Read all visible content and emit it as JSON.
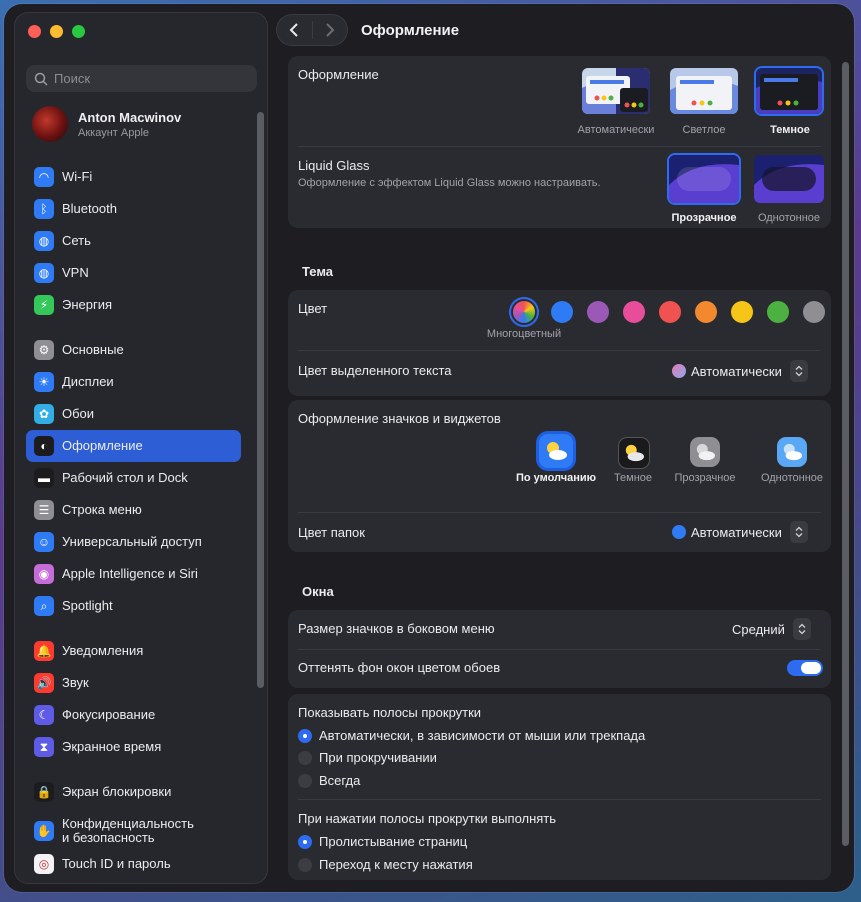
{
  "window": {
    "title": "Оформление"
  },
  "sidebar": {
    "search_placeholder": "Поиск",
    "account": {
      "name": "Anton Macwinov",
      "subtitle": "Аккаунт Apple"
    },
    "items": [
      {
        "label": "Wi-Fi",
        "icon": "wifi-icon",
        "color": "#2f7bf5"
      },
      {
        "label": "Bluetooth",
        "icon": "bluetooth-icon",
        "color": "#2f7bf5"
      },
      {
        "label": "Сеть",
        "icon": "globe-icon",
        "color": "#2f7bf5"
      },
      {
        "label": "VPN",
        "icon": "vpn-globe-icon",
        "color": "#2f7bf5"
      },
      {
        "label": "Энергия",
        "icon": "battery-bolt-icon",
        "color": "#34c759"
      },
      {
        "label": "Основные",
        "icon": "gear-icon",
        "color": "#8e8e93"
      },
      {
        "label": "Дисплеи",
        "icon": "sun-icon",
        "color": "#2f7bf5"
      },
      {
        "label": "Обои",
        "icon": "flower-icon",
        "color": "#32ade6"
      },
      {
        "label": "Оформление",
        "icon": "appearance-icon",
        "color": "#1c1c1e"
      },
      {
        "label": "Рабочий стол и Dock",
        "icon": "dock-icon",
        "color": "#1c1c1e"
      },
      {
        "label": "Строка меню",
        "icon": "menubar-icon",
        "color": "#8e8e93"
      },
      {
        "label": "Универсальный доступ",
        "icon": "accessibility-icon",
        "color": "#2f7bf5"
      },
      {
        "label": "Apple Intelligence и Siri",
        "icon": "siri-icon",
        "color": "#c66cd8"
      },
      {
        "label": "Spotlight",
        "icon": "magnifier-icon",
        "color": "#2f7bf5"
      },
      {
        "label": "Уведомления",
        "icon": "bell-icon",
        "color": "#ff3b30"
      },
      {
        "label": "Звук",
        "icon": "speaker-icon",
        "color": "#ff3b30"
      },
      {
        "label": "Фокусирование",
        "icon": "moon-icon",
        "color": "#5e5ce6"
      },
      {
        "label": "Экранное время",
        "icon": "hourglass-icon",
        "color": "#5e5ce6"
      },
      {
        "label": "Экран блокировки",
        "icon": "lock-icon",
        "color": "#1c1c1e"
      },
      {
        "label": "Конфиденциальность\nи безопасность",
        "icon": "hand-icon",
        "color": "#2f7bf5"
      },
      {
        "label": "Touch ID и пароль",
        "icon": "fingerprint-icon",
        "color": "#f2f2f7"
      }
    ],
    "active_index": 8
  },
  "appearance": {
    "label": "Оформление",
    "options": [
      "Автоматически",
      "Светлое",
      "Темное"
    ],
    "selected": "Темное"
  },
  "liquid_glass": {
    "label": "Liquid Glass",
    "description": "Оформление с эффектом Liquid Glass можно настраивать.",
    "options": [
      "Прозрачное",
      "Однотонное"
    ],
    "selected": "Прозрачное"
  },
  "theme": {
    "title": "Тема",
    "color_label": "Цвет",
    "colors": [
      "#ff9f0a-multi",
      "#2f7bf5",
      "#9b59b6",
      "#e84d9a",
      "#f05252",
      "#f2892e",
      "#f5c518",
      "#4cb140",
      "#8e8e93"
    ],
    "selected_color_caption": "Многоцветный",
    "highlight_label": "Цвет выделенного текста",
    "highlight_value": "Автоматически"
  },
  "icons_widgets": {
    "title": "Оформление значков и виджетов",
    "options": [
      "По умолчанию",
      "Темное",
      "Прозрачное",
      "Однотонное"
    ],
    "selected": "По умолчанию",
    "folder_color_label": "Цвет папок",
    "folder_color_value": "Автоматически"
  },
  "windows": {
    "title": "Окна",
    "sidebar_icon_size_label": "Размер значков в боковом меню",
    "sidebar_icon_size_value": "Средний",
    "tint_label": "Оттенять фон окон цветом обоев",
    "tint_on": true
  },
  "scrollbars": {
    "show_label": "Показывать полосы прокрутки",
    "show_options": [
      "Автоматически, в зависимости от мыши или трекпада",
      "При прокручивании",
      "Всегда"
    ],
    "show_selected": 0,
    "click_label": "При нажатии полосы прокрутки выполнять",
    "click_options": [
      "Пролистывание страниц",
      "Переход к месту нажатия"
    ],
    "click_selected": 0
  }
}
